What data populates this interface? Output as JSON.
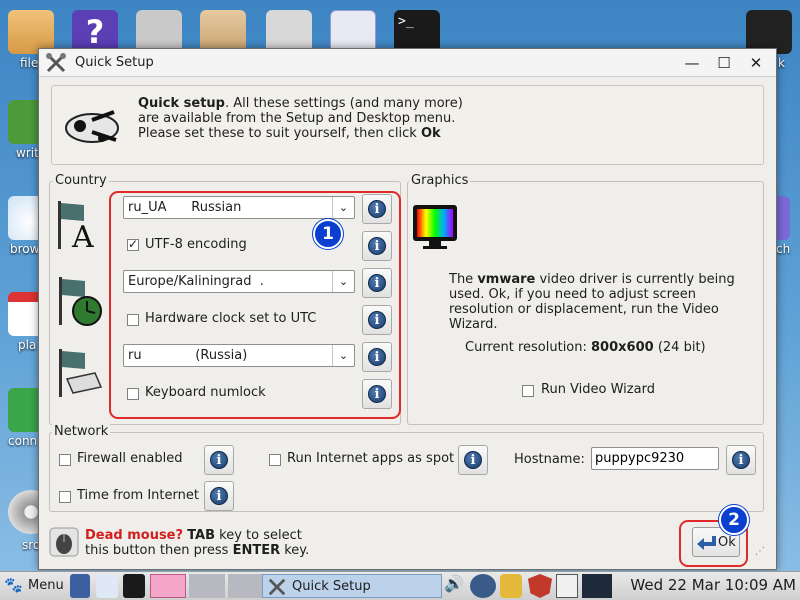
{
  "desktop": {
    "left_labels": [
      "file",
      "writ",
      "brow",
      "pla",
      "conn",
      "sro"
    ],
    "right_labels": [
      "k",
      "ch"
    ]
  },
  "window": {
    "title": "Quick Setup",
    "intro": {
      "bold_lead": "Quick setup",
      "text": ". All these settings (and many more) are available from the Setup and Desktop menu. Please set these to suit yourself, then click ",
      "bold_end": "Ok"
    },
    "country": {
      "label": "Country",
      "locale_value": "ru_UA      Russian",
      "utf8_label": "UTF-8 encoding",
      "utf8_checked": true,
      "timezone_value": "Europe/Kaliningrad  .",
      "hwclock_label": "Hardware clock set to UTC",
      "hwclock_checked": false,
      "keyboard_value": "ru             (Russia)",
      "numlock_label": "Keyboard numlock",
      "numlock_checked": false,
      "badge": "1"
    },
    "graphics": {
      "label": "Graphics",
      "desc_pre": "The ",
      "desc_bold": "vmware",
      "desc_post": " video driver is currently being used. Ok, if you need to adjust screen resolution or displacement, run the Video Wizard.",
      "resolution_label": "Current resolution:",
      "resolution_value": "800x600",
      "resolution_bits": "(24 bit)",
      "wizard_label": "Run Video Wizard",
      "wizard_checked": false
    },
    "network": {
      "label": "Network",
      "firewall_label": "Firewall enabled",
      "spot_label": "Run Internet apps as spot",
      "internet_label": "Time from Internet",
      "hostname_label": "Hostname:",
      "hostname_value": "puppypc9230"
    },
    "footer": {
      "dead_mouse": "Dead mouse?",
      "tab": "TAB",
      "line1_rest": " key to select",
      "line2_pre": "this button then press ",
      "enter": "ENTER",
      "line2_post": " key.",
      "ok_label": "Ok",
      "badge": "2"
    }
  },
  "taskbar": {
    "menu_label": "Menu",
    "task_label": "Quick Setup",
    "clock": "Wed 22 Mar 10:09 AM"
  },
  "colors": {
    "accent_red": "#e02a2a",
    "badge_blue": "#0a3fd0",
    "dead_mouse_red": "#d21e1e"
  }
}
